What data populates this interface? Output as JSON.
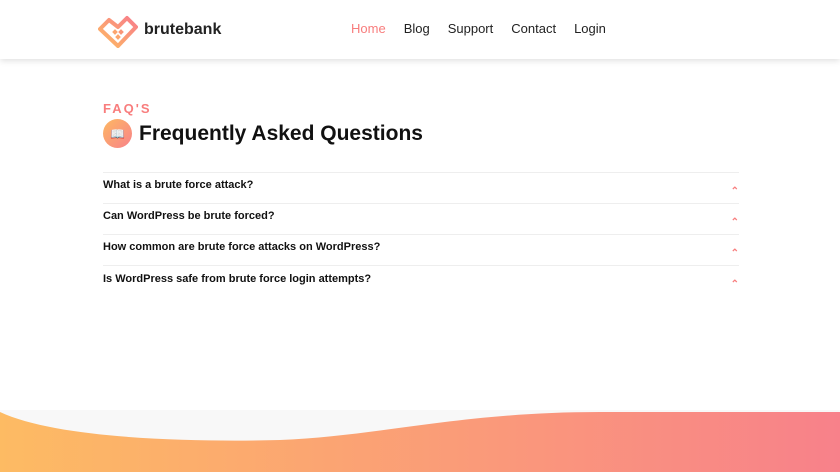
{
  "brand": {
    "name": "brutebank"
  },
  "nav": [
    {
      "label": "Home",
      "active": true
    },
    {
      "label": "Blog"
    },
    {
      "label": "Support"
    },
    {
      "label": "Contact"
    },
    {
      "label": "Login"
    }
  ],
  "faq": {
    "eyebrow": "FAQ'S",
    "title": "Frequently Asked Questions",
    "items": [
      {
        "q": "What is a brute force attack?"
      },
      {
        "q": "Can WordPress be brute forced?"
      },
      {
        "q": "How common are brute force attacks on WordPress?"
      },
      {
        "q": "Is WordPress safe from brute force login attempts?"
      }
    ]
  },
  "colors": {
    "accent": "#f87d7d",
    "gradient_start": "#fdbb63",
    "gradient_end": "#f8818a"
  }
}
